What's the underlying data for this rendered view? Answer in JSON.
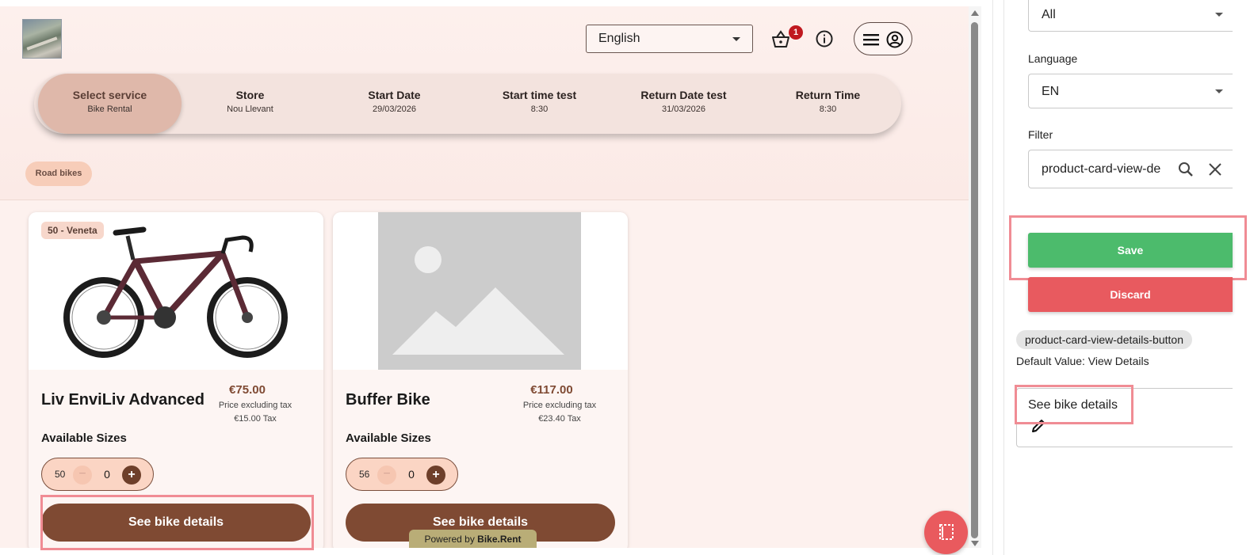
{
  "header": {
    "language_value": "English",
    "cart_count": "1"
  },
  "stepper": [
    {
      "title": "Select service",
      "value": "Bike Rental"
    },
    {
      "title": "Store",
      "value": "Nou Llevant"
    },
    {
      "title": "Start Date",
      "value": "29/03/2026"
    },
    {
      "title": "Start time test",
      "value": "8:30"
    },
    {
      "title": "Return Date test",
      "value": "31/03/2026"
    },
    {
      "title": "Return Time",
      "value": "8:30"
    }
  ],
  "category_chip": "Road bikes",
  "cards": [
    {
      "size_tag": "50 - Veneta",
      "name": "Liv EnviLiv Advanced",
      "price": "€75.00",
      "price_note": "Price excluding tax",
      "tax": "€15.00 Tax",
      "available_sizes_label": "Available Sizes",
      "size": "50",
      "minus": "−",
      "count": "0",
      "plus": "+",
      "cta": "See bike details"
    },
    {
      "size_tag": "",
      "name": "Buffer Bike",
      "price": "€117.00",
      "price_note": "Price excluding tax",
      "tax": "€23.40 Tax",
      "available_sizes_label": "Available Sizes",
      "size": "56",
      "minus": "−",
      "count": "0",
      "plus": "+",
      "cta": "See bike details"
    }
  ],
  "powered": {
    "prefix": "Powered by ",
    "brand": "Bike.Rent"
  },
  "editor": {
    "top_select_value": "All",
    "language_label": "Language",
    "language_value": "EN",
    "filter_label": "Filter",
    "filter_value": "product-card-view-de",
    "save_label": "Save",
    "discard_label": "Discard",
    "key_name": "product-card-view-details-button",
    "default_value": "Default Value: View Details",
    "edit_value": "See bike details"
  },
  "colors": {
    "brand_brown": "#7f4a33",
    "save_green": "#4cbb6c",
    "discard_red": "#e85a5f",
    "highlight_pink": "#f08c94",
    "badge_red": "#c0181f"
  },
  "icons": [
    "basket-icon",
    "info-icon",
    "hamburger-icon",
    "account-icon",
    "chevron-down-icon",
    "search-icon",
    "close-icon",
    "pencil-icon",
    "translate-editor-icon"
  ]
}
